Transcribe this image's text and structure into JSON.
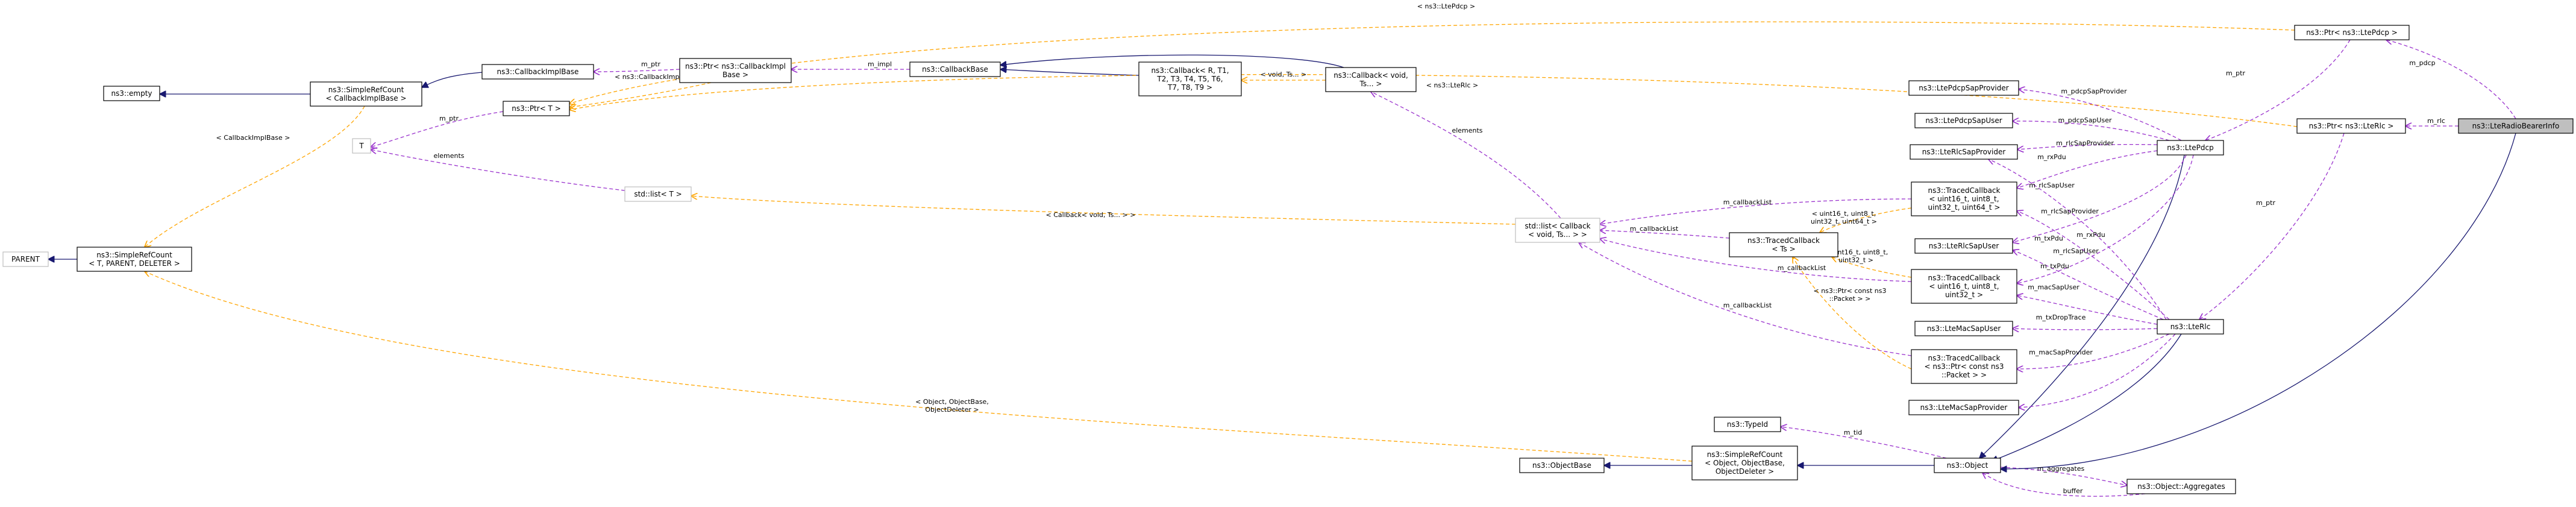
{
  "nodes": [
    {
      "id": "n_parent",
      "lines": [
        "PARENT"
      ],
      "style": "gray"
    },
    {
      "id": "n_srcount_tpl",
      "lines": [
        "ns3::SimpleRefCount",
        "< T, PARENT, DELETER >"
      ],
      "style": "normal"
    },
    {
      "id": "n_empty",
      "lines": [
        "ns3::empty"
      ],
      "style": "normal"
    },
    {
      "id": "n_srcount_cb",
      "lines": [
        "ns3::SimpleRefCount",
        "< CallbackImplBase >"
      ],
      "style": "normal"
    },
    {
      "id": "n_cbimplbase",
      "lines": [
        "ns3::CallbackImplBase"
      ],
      "style": "normal"
    },
    {
      "id": "n_ptr_t",
      "lines": [
        "ns3::Ptr< T >"
      ],
      "style": "normal"
    },
    {
      "id": "n_t",
      "lines": [
        "T"
      ],
      "style": "gray"
    },
    {
      "id": "n_stdlist_t",
      "lines": [
        "std::list< T >"
      ],
      "style": "gray"
    },
    {
      "id": "n_ptr_cbimpl",
      "lines": [
        "ns3::Ptr< ns3::CallbackImpl",
        "Base >"
      ],
      "style": "normal"
    },
    {
      "id": "n_cbbase",
      "lines": [
        "ns3::CallbackBase"
      ],
      "style": "normal"
    },
    {
      "id": "n_callback_rt",
      "lines": [
        "ns3::Callback< R, T1,",
        "T2, T3, T4, T5, T6,",
        "T7, T8, T9 >"
      ],
      "style": "normal"
    },
    {
      "id": "n_callback_void",
      "lines": [
        "ns3::Callback< void,",
        "Ts... >"
      ],
      "style": "normal"
    },
    {
      "id": "n_stdlist_cb",
      "lines": [
        "std::list< Callback",
        "< void, Ts... > >"
      ],
      "style": "gray"
    },
    {
      "id": "n_tracedcb_ts",
      "lines": [
        "ns3::TracedCallback",
        "< Ts >"
      ],
      "style": "normal"
    },
    {
      "id": "n_tracedcb_u64",
      "lines": [
        "ns3::TracedCallback",
        "< uint16_t, uint8_t,",
        "uint32_t, uint64_t >"
      ],
      "style": "normal"
    },
    {
      "id": "n_tracedcb_u32",
      "lines": [
        "ns3::TracedCallback",
        "< uint16_t, uint8_t,",
        "uint32_t >"
      ],
      "style": "normal"
    },
    {
      "id": "n_tracedcb_pkt",
      "lines": [
        "ns3::TracedCallback",
        "< ns3::Ptr< const ns3",
        "::Packet > >"
      ],
      "style": "normal"
    },
    {
      "id": "n_pdcpsapprov",
      "lines": [
        "ns3::LtePdcpSapProvider"
      ],
      "style": "normal"
    },
    {
      "id": "n_pdcpsapuser",
      "lines": [
        "ns3::LtePdcpSapUser"
      ],
      "style": "normal"
    },
    {
      "id": "n_rlcsapprov",
      "lines": [
        "ns3::LteRlcSapProvider"
      ],
      "style": "normal"
    },
    {
      "id": "n_rlcsapuser",
      "lines": [
        "ns3::LteRlcSapUser"
      ],
      "style": "normal"
    },
    {
      "id": "n_macsapuser",
      "lines": [
        "ns3::LteMacSapUser"
      ],
      "style": "normal"
    },
    {
      "id": "n_macsapprov",
      "lines": [
        "ns3::LteMacSapProvider"
      ],
      "style": "normal"
    },
    {
      "id": "n_typeid",
      "lines": [
        "ns3::TypeId"
      ],
      "style": "normal"
    },
    {
      "id": "n_objectbase",
      "lines": [
        "ns3::ObjectBase"
      ],
      "style": "normal"
    },
    {
      "id": "n_srcount_obj",
      "lines": [
        "ns3::SimpleRefCount",
        "< Object, ObjectBase,",
        "ObjectDeleter >"
      ],
      "style": "normal"
    },
    {
      "id": "n_object",
      "lines": [
        "ns3::Object"
      ],
      "style": "normal"
    },
    {
      "id": "n_aggregates",
      "lines": [
        "ns3::Object::Aggregates"
      ],
      "style": "normal"
    },
    {
      "id": "n_ltepdcp",
      "lines": [
        "ns3::LtePdcp"
      ],
      "style": "normal"
    },
    {
      "id": "n_lterlc",
      "lines": [
        "ns3::LteRlc"
      ],
      "style": "normal"
    },
    {
      "id": "n_ptr_pdcp",
      "lines": [
        "ns3::Ptr< ns3::LtePdcp >"
      ],
      "style": "normal"
    },
    {
      "id": "n_ptr_rlc",
      "lines": [
        "ns3::Ptr< ns3::LteRlc >"
      ],
      "style": "normal"
    },
    {
      "id": "n_rbinfo",
      "lines": [
        "ns3::LteRadioBearerInfo"
      ],
      "style": "focus"
    }
  ],
  "edges": [
    {
      "id": "e_parent",
      "kind": "inheritance",
      "label": ""
    },
    {
      "id": "e_empty",
      "kind": "inheritance",
      "label": ""
    },
    {
      "id": "e_srcount_cbimpl",
      "kind": "inheritance",
      "label": ""
    },
    {
      "id": "e_tpl_cbimpl",
      "kind": "template",
      "label": "< CallbackImplBase >"
    },
    {
      "id": "e_tpl_obj",
      "kind": "template",
      "label": "< Object, ObjectBase,\nObjectDeleter >"
    },
    {
      "id": "e_t_ptr",
      "kind": "usage",
      "label": "m_ptr"
    },
    {
      "id": "e_t_list",
      "kind": "usage",
      "label": "elements"
    },
    {
      "id": "e_tpl_ptr_cbimpl",
      "kind": "template",
      "label": "< ns3::CallbackImplBase >"
    },
    {
      "id": "e_cbimpl_ptr",
      "kind": "usage",
      "label": "m_ptr"
    },
    {
      "id": "e_impl",
      "kind": "usage",
      "label": "m_impl"
    },
    {
      "id": "e_cb_rt",
      "kind": "inheritance",
      "label": ""
    },
    {
      "id": "e_cb_void",
      "kind": "inheritance",
      "label": ""
    },
    {
      "id": "e_tpl_cbvoid",
      "kind": "template",
      "label": "< void, Ts... >"
    },
    {
      "id": "e_elements",
      "kind": "usage",
      "label": "elements"
    },
    {
      "id": "e_tpl_list",
      "kind": "template",
      "label": "< Callback< void, Ts... > >"
    },
    {
      "id": "e_cl_u64",
      "kind": "usage",
      "label": "m_callbackList"
    },
    {
      "id": "e_cl_ts",
      "kind": "usage",
      "label": "m_callbackList"
    },
    {
      "id": "e_cl_u32",
      "kind": "usage",
      "label": "m_callbackList"
    },
    {
      "id": "e_cl_pkt",
      "kind": "usage",
      "label": "m_callbackList"
    },
    {
      "id": "e_tpl_u64",
      "kind": "template",
      "label": "< uint16_t, uint8_t,\nuint32_t, uint64_t >"
    },
    {
      "id": "e_tpl_u32",
      "kind": "template",
      "label": "< uint16_t, uint8_t,\nuint32_t >"
    },
    {
      "id": "e_tpl_pkt",
      "kind": "template",
      "label": "< ns3::Ptr< const ns3\n::Packet > >"
    },
    {
      "id": "e_tpl_pdcp",
      "kind": "template",
      "label": "< ns3::LtePdcp >"
    },
    {
      "id": "e_tpl_rlc",
      "kind": "template",
      "label": "< ns3::LteRlc >"
    },
    {
      "id": "e_tid",
      "kind": "usage",
      "label": "m_tid"
    },
    {
      "id": "e_objbase",
      "kind": "inheritance",
      "label": ""
    },
    {
      "id": "e_srcount_obj",
      "kind": "inheritance",
      "label": ""
    },
    {
      "id": "e_aggregates",
      "kind": "usage",
      "label": "m_aggregates"
    },
    {
      "id": "e_buffer",
      "kind": "usage",
      "label": "buffer"
    },
    {
      "id": "e_pdcp_obj",
      "kind": "inheritance",
      "label": ""
    },
    {
      "id": "e_rlc_obj",
      "kind": "inheritance",
      "label": ""
    },
    {
      "id": "e_rb_obj",
      "kind": "inheritance",
      "label": ""
    },
    {
      "id": "e_pdcpsapprov",
      "kind": "usage",
      "label": "m_pdcpSapProvider"
    },
    {
      "id": "e_pdcpsapuser",
      "kind": "usage",
      "label": "m_pdcpSapUser"
    },
    {
      "id": "e_pdcp_rlcsapprov",
      "kind": "usage",
      "label": "m_rlcSapProvider"
    },
    {
      "id": "e_pdcp_rxpdu",
      "kind": "usage",
      "label": "m_rxPdu"
    },
    {
      "id": "e_pdcp_rlcsapuser",
      "kind": "usage",
      "label": "m_rlcSapUser"
    },
    {
      "id": "e_pdcp_txpdu",
      "kind": "usage",
      "label": "m_txPdu"
    },
    {
      "id": "e_rlc_rlcsapprov",
      "kind": "usage",
      "label": "m_rlcSapProvider"
    },
    {
      "id": "e_rlc_rxpdu",
      "kind": "usage",
      "label": "m_rxPdu"
    },
    {
      "id": "e_rlc_rlcsapuser",
      "kind": "usage",
      "label": "m_rlcSapUser"
    },
    {
      "id": "e_rlc_txpdu",
      "kind": "usage",
      "label": "m_txPdu"
    },
    {
      "id": "e_rlc_macsapuser",
      "kind": "usage",
      "label": "m_macSapUser"
    },
    {
      "id": "e_rlc_txdrop",
      "kind": "usage",
      "label": "m_txDropTrace"
    },
    {
      "id": "e_rlc_macsapprov",
      "kind": "usage",
      "label": "m_macSapProvider"
    },
    {
      "id": "e_ptr_pdcp",
      "kind": "usage",
      "label": "m_ptr"
    },
    {
      "id": "e_ptr_rlc",
      "kind": "usage",
      "label": "m_ptr"
    },
    {
      "id": "e_rb_pdcp",
      "kind": "usage",
      "label": "m_pdcp"
    },
    {
      "id": "e_rb_rlc",
      "kind": "usage",
      "label": "m_rlc"
    }
  ]
}
